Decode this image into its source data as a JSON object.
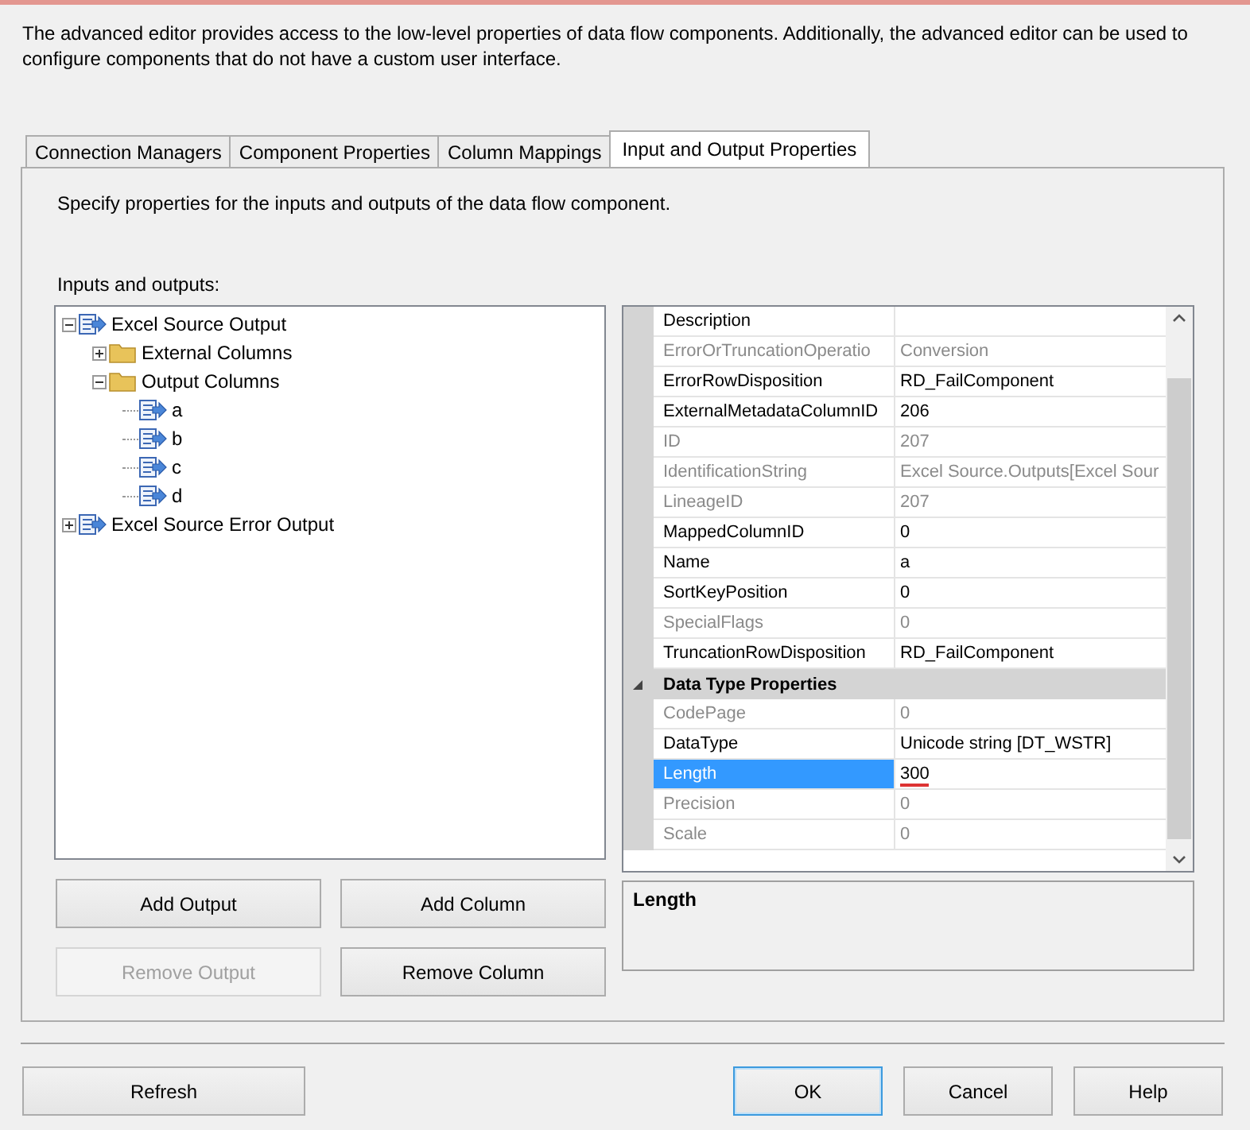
{
  "description": "The advanced editor provides access to the low-level properties of data flow components. Additionally, the advanced editor can be used to configure components that do not have a custom user interface.",
  "tabs": [
    {
      "label": "Connection Managers",
      "selected": false
    },
    {
      "label": "Component Properties",
      "selected": false
    },
    {
      "label": "Column Mappings",
      "selected": false
    },
    {
      "label": "Input and Output Properties",
      "selected": true
    }
  ],
  "hint": "Specify properties for the inputs and outputs of the data flow component.",
  "tree_label": "Inputs and outputs:",
  "tree": [
    {
      "label": "Excel Source Output",
      "kind": "output",
      "expanded": true,
      "children": [
        {
          "label": "External Columns",
          "kind": "folder",
          "expanded": false
        },
        {
          "label": "Output Columns",
          "kind": "folder",
          "expanded": true,
          "children": [
            {
              "label": "a",
              "kind": "column"
            },
            {
              "label": "b",
              "kind": "column"
            },
            {
              "label": "c",
              "kind": "column"
            },
            {
              "label": "d",
              "kind": "column"
            }
          ]
        }
      ]
    },
    {
      "label": "Excel Source Error Output",
      "kind": "output",
      "expanded": false
    }
  ],
  "properties": [
    {
      "kind": "property",
      "name": "Description",
      "disabled": false,
      "selected": false
    },
    {
      "kind": "property",
      "name": "ErrorOrTruncationOperatio",
      "value": "Conversion",
      "disabled": true,
      "selected": false
    },
    {
      "kind": "property",
      "name": "ErrorRowDisposition",
      "value": "RD_FailComponent",
      "disabled": false,
      "selected": false
    },
    {
      "kind": "property",
      "name": "ExternalMetadataColumnID",
      "value": "206",
      "disabled": false,
      "selected": false
    },
    {
      "kind": "property",
      "name": "ID",
      "value": "207",
      "disabled": true,
      "selected": false
    },
    {
      "kind": "property",
      "name": "IdentificationString",
      "value": "Excel Source.Outputs[Excel Sour",
      "disabled": true,
      "selected": false
    },
    {
      "kind": "property",
      "name": "LineageID",
      "value": "207",
      "disabled": true,
      "selected": false
    },
    {
      "kind": "property",
      "name": "MappedColumnID",
      "value": "0",
      "disabled": false,
      "selected": false
    },
    {
      "kind": "property",
      "name": "Name",
      "value": "a",
      "disabled": false,
      "selected": false
    },
    {
      "kind": "property",
      "name": "SortKeyPosition",
      "value": "0",
      "disabled": false,
      "selected": false
    },
    {
      "kind": "property",
      "name": "SpecialFlags",
      "value": "0",
      "disabled": true,
      "selected": false
    },
    {
      "kind": "property",
      "name": "TruncationRowDisposition",
      "value": "RD_FailComponent",
      "disabled": false,
      "selected": false
    },
    {
      "kind": "category",
      "name": "Data Type Properties",
      "expanded": true
    },
    {
      "kind": "property",
      "name": "CodePage",
      "value": "0",
      "disabled": true,
      "selected": false
    },
    {
      "kind": "property",
      "name": "DataType",
      "value": "Unicode string [DT_WSTR]",
      "disabled": false,
      "selected": false
    },
    {
      "kind": "property",
      "name": "Length",
      "value": "300",
      "disabled": false,
      "selected": true
    },
    {
      "kind": "property",
      "name": "Precision",
      "value": "0",
      "disabled": true,
      "selected": false
    },
    {
      "kind": "property",
      "name": "Scale",
      "value": "0",
      "disabled": true,
      "selected": false
    }
  ],
  "property_description": "Length",
  "tree_buttons": [
    {
      "label": "Add Output",
      "disabled": false
    },
    {
      "label": "Add Column",
      "disabled": false
    },
    {
      "label": "Remove Output",
      "disabled": true
    },
    {
      "label": "Remove Column",
      "disabled": false
    }
  ],
  "footer_buttons": [
    {
      "label": "Refresh",
      "default": false
    },
    {
      "label": "OK",
      "default": true
    },
    {
      "label": "Cancel",
      "default": false
    },
    {
      "label": "Help",
      "default": false
    }
  ]
}
